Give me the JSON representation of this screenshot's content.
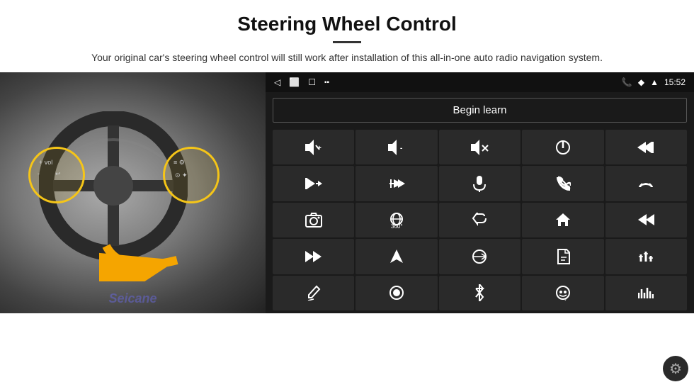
{
  "header": {
    "title": "Steering Wheel Control",
    "subtitle": "Your original car's steering wheel control will still work after installation of this all-in-one auto radio navigation system."
  },
  "android": {
    "statusbar": {
      "back_icon": "◁",
      "home_icon": "⬜",
      "recents_icon": "☐",
      "notifications_icon": "▪▪",
      "phone_icon": "📞",
      "wifi_icon": "◆",
      "time": "15:52"
    },
    "begin_learn_label": "Begin learn",
    "controls": [
      {
        "icon": "🔊+",
        "label": "vol-up"
      },
      {
        "icon": "🔊-",
        "label": "vol-down"
      },
      {
        "icon": "🔇",
        "label": "mute"
      },
      {
        "icon": "⏻",
        "label": "power"
      },
      {
        "icon": "⏮",
        "label": "prev-track"
      },
      {
        "icon": "⏭",
        "label": "next"
      },
      {
        "icon": "✂⏭",
        "label": "fast-forward"
      },
      {
        "icon": "🎙",
        "label": "mic"
      },
      {
        "icon": "📞",
        "label": "phone"
      },
      {
        "icon": "📞↩",
        "label": "hang-up"
      },
      {
        "icon": "📷",
        "label": "camera"
      },
      {
        "icon": "👁360",
        "label": "360-view"
      },
      {
        "icon": "↩",
        "label": "back"
      },
      {
        "icon": "🏠",
        "label": "home"
      },
      {
        "icon": "⏮⏮",
        "label": "prev"
      },
      {
        "icon": "⏭⏭",
        "label": "skip"
      },
      {
        "icon": "➤",
        "label": "nav"
      },
      {
        "icon": "⇄",
        "label": "switch"
      },
      {
        "icon": "🎵",
        "label": "music-file"
      },
      {
        "icon": "🎚",
        "label": "equalizer"
      },
      {
        "icon": "✏",
        "label": "edit"
      },
      {
        "icon": "⏺",
        "label": "record"
      },
      {
        "icon": "✳",
        "label": "bluetooth"
      },
      {
        "icon": "🎵",
        "label": "media"
      },
      {
        "icon": "📊",
        "label": "audio-level"
      }
    ]
  },
  "seicane": {
    "label": "Seicane"
  },
  "gear": {
    "label": "⚙"
  }
}
